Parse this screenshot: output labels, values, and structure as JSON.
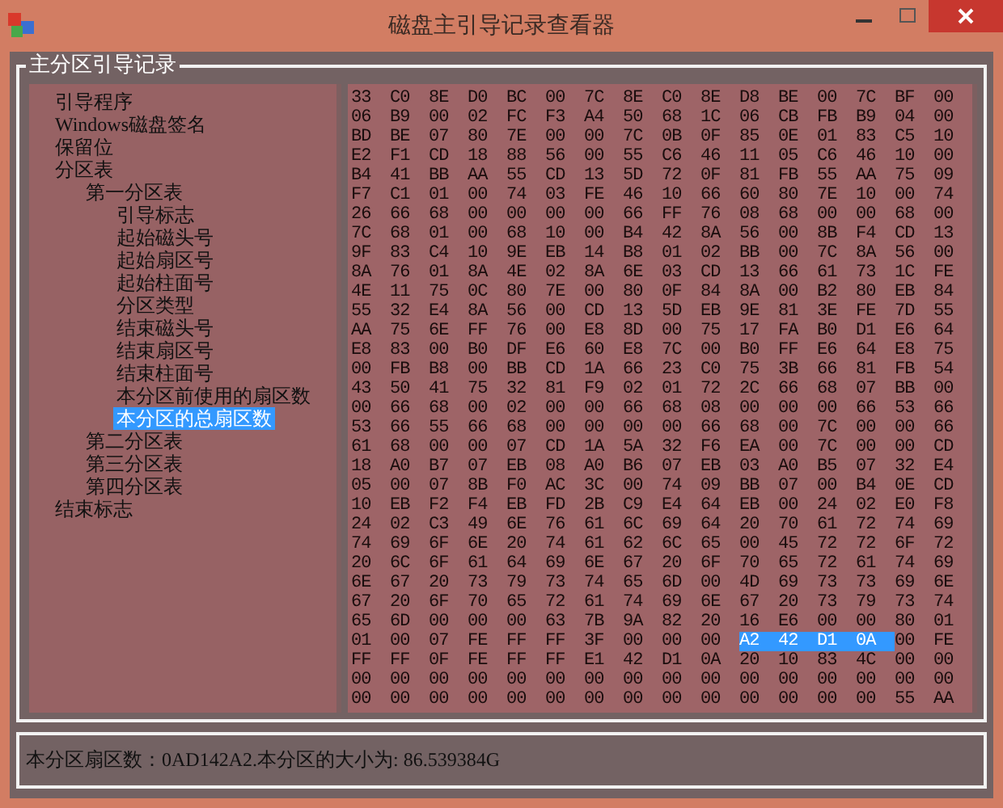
{
  "window": {
    "title": "磁盘主引导记录查看器"
  },
  "group": {
    "title": "主分区引导记录"
  },
  "tree": [
    {
      "label": "引导程序",
      "selected": false
    },
    {
      "label": "Windows磁盘签名",
      "selected": false
    },
    {
      "label": "保留位",
      "selected": false
    },
    {
      "label": "分区表",
      "selected": false,
      "children": [
        {
          "label": "第一分区表",
          "selected": false,
          "children": [
            {
              "label": "引导标志",
              "selected": false
            },
            {
              "label": "起始磁头号",
              "selected": false
            },
            {
              "label": "起始扇区号",
              "selected": false
            },
            {
              "label": "起始柱面号",
              "selected": false
            },
            {
              "label": "分区类型",
              "selected": false
            },
            {
              "label": "结束磁头号",
              "selected": false
            },
            {
              "label": "结束扇区号",
              "selected": false
            },
            {
              "label": "结束柱面号",
              "selected": false
            },
            {
              "label": "本分区前使用的扇区数",
              "selected": false
            },
            {
              "label": "本分区的总扇区数",
              "selected": true
            }
          ]
        },
        {
          "label": "第二分区表",
          "selected": false
        },
        {
          "label": "第三分区表",
          "selected": false
        },
        {
          "label": "第四分区表",
          "selected": false
        }
      ]
    },
    {
      "label": "结束标志",
      "selected": false
    }
  ],
  "hex_rows": [
    [
      {
        "bytes": "33 C0 8E D0 BC 00 7C 8E C0 8E D8 BE 00 7C BF 00",
        "selected": false
      }
    ],
    [
      {
        "bytes": "06 B9 00 02 FC F3 A4 50 68 1C 06 CB FB B9 04 00",
        "selected": false
      }
    ],
    [
      {
        "bytes": "BD BE 07 80 7E 00 00 7C 0B 0F 85 0E 01 83 C5 10",
        "selected": false
      }
    ],
    [
      {
        "bytes": "E2 F1 CD 18 88 56 00 55 C6 46 11 05 C6 46 10 00",
        "selected": false
      }
    ],
    [
      {
        "bytes": "B4 41 BB AA 55 CD 13 5D 72 0F 81 FB 55 AA 75 09",
        "selected": false
      }
    ],
    [
      {
        "bytes": "F7 C1 01 00 74 03 FE 46 10 66 60 80 7E 10 00 74",
        "selected": false
      }
    ],
    [
      {
        "bytes": "26 66 68 00 00 00 00 66 FF 76 08 68 00 00 68 00",
        "selected": false
      }
    ],
    [
      {
        "bytes": "7C 68 01 00 68 10 00 B4 42 8A 56 00 8B F4 CD 13",
        "selected": false
      }
    ],
    [
      {
        "bytes": "9F 83 C4 10 9E EB 14 B8 01 02 BB 00 7C 8A 56 00",
        "selected": false
      }
    ],
    [
      {
        "bytes": "8A 76 01 8A 4E 02 8A 6E 03 CD 13 66 61 73 1C FE",
        "selected": false
      }
    ],
    [
      {
        "bytes": "4E 11 75 0C 80 7E 00 80 0F 84 8A 00 B2 80 EB 84",
        "selected": false
      }
    ],
    [
      {
        "bytes": "55 32 E4 8A 56 00 CD 13 5D EB 9E 81 3E FE 7D 55",
        "selected": false
      }
    ],
    [
      {
        "bytes": "AA 75 6E FF 76 00 E8 8D 00 75 17 FA B0 D1 E6 64",
        "selected": false
      }
    ],
    [
      {
        "bytes": "E8 83 00 B0 DF E6 60 E8 7C 00 B0 FF E6 64 E8 75",
        "selected": false
      }
    ],
    [
      {
        "bytes": "00 FB B8 00 BB CD 1A 66 23 C0 75 3B 66 81 FB 54",
        "selected": false
      }
    ],
    [
      {
        "bytes": "43 50 41 75 32 81 F9 02 01 72 2C 66 68 07 BB 00",
        "selected": false
      }
    ],
    [
      {
        "bytes": "00 66 68 00 02 00 00 66 68 08 00 00 00 66 53 66",
        "selected": false
      }
    ],
    [
      {
        "bytes": "53 66 55 66 68 00 00 00 00 66 68 00 7C 00 00 66",
        "selected": false
      }
    ],
    [
      {
        "bytes": "61 68 00 00 07 CD 1A 5A 32 F6 EA 00 7C 00 00 CD",
        "selected": false
      }
    ],
    [
      {
        "bytes": "18 A0 B7 07 EB 08 A0 B6 07 EB 03 A0 B5 07 32 E4",
        "selected": false
      }
    ],
    [
      {
        "bytes": "05 00 07 8B F0 AC 3C 00 74 09 BB 07 00 B4 0E CD",
        "selected": false
      }
    ],
    [
      {
        "bytes": "10 EB F2 F4 EB FD 2B C9 E4 64 EB 00 24 02 E0 F8",
        "selected": false
      }
    ],
    [
      {
        "bytes": "24 02 C3 49 6E 76 61 6C 69 64 20 70 61 72 74 69",
        "selected": false
      }
    ],
    [
      {
        "bytes": "74 69 6F 6E 20 74 61 62 6C 65 00 45 72 72 6F 72",
        "selected": false
      }
    ],
    [
      {
        "bytes": "20 6C 6F 61 64 69 6E 67 20 6F 70 65 72 61 74 69",
        "selected": false
      }
    ],
    [
      {
        "bytes": "6E 67 20 73 79 73 74 65 6D 00 4D 69 73 73 69 6E",
        "selected": false
      }
    ],
    [
      {
        "bytes": "67 20 6F 70 65 72 61 74 69 6E 67 20 73 79 73 74",
        "selected": false
      }
    ],
    [
      {
        "bytes": "65 6D 00 00 00 63 7B 9A 82 20 16 E6 00 00 80 01",
        "selected": false
      }
    ],
    [
      {
        "bytes": "01 00 07 FE FF FF 3F 00 00 00",
        "selected": false
      },
      {
        "bytes": "A2 42 D1 0A",
        "selected": true
      },
      {
        "bytes": "00 FE",
        "selected": false
      }
    ],
    [
      {
        "bytes": "FF FF 0F FE FF FF E1 42 D1 0A 20 10 83 4C 00 00",
        "selected": false
      }
    ],
    [
      {
        "bytes": "00 00 00 00 00 00 00 00 00 00 00 00 00 00 00 00",
        "selected": false
      }
    ],
    [
      {
        "bytes": "00 00 00 00 00 00 00 00 00 00 00 00 00 00 55 AA",
        "selected": false
      }
    ]
  ],
  "status": "本分区扇区数：0AD142A2.本分区的大小为: 86.539384G"
}
